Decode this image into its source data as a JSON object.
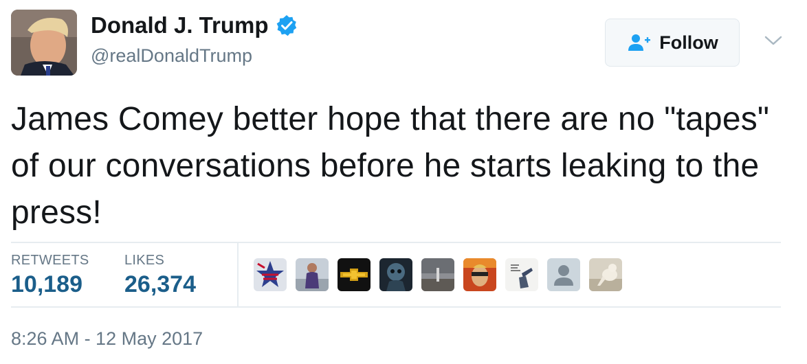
{
  "author": {
    "name": "Donald J. Trump",
    "handle": "@realDonaldTrump",
    "verified": true
  },
  "follow_button": {
    "label": "Follow",
    "icon": "add-user-icon"
  },
  "menu_icon": "chevron-down-icon",
  "tweet": {
    "text": "James Comey better hope that there are no \"tapes\" of our conversations before he starts leaking to the press!"
  },
  "stats": {
    "retweets_label": "RETWEETS",
    "retweets_value": "10,189",
    "likes_label": "LIKES",
    "likes_value": "26,374"
  },
  "liker_avatar_count": 9,
  "timestamp": "8:26 AM - 12 May 2017",
  "colors": {
    "text": "#14171a",
    "secondary": "#657786",
    "stat_value": "#1b5e8a",
    "verified": "#1da1f2",
    "divider": "#e6ecf0"
  }
}
